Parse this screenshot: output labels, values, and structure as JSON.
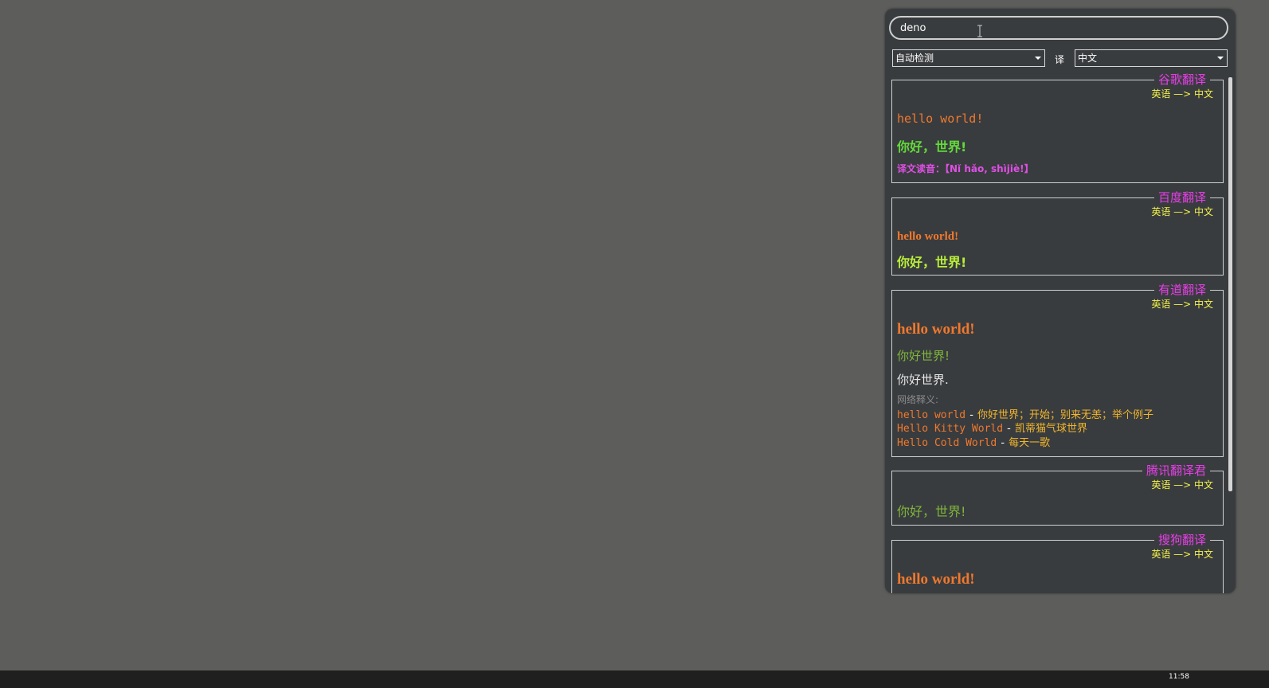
{
  "search": {
    "value": "deno"
  },
  "controls": {
    "source_lang": "自动检测",
    "translate_label": "译",
    "target_lang": "中文"
  },
  "results": [
    {
      "engine": "谷歌翻译",
      "direction": "英语 —> 中文",
      "source_text": "hello world!",
      "translation": "你好，世界!",
      "pronunciation": "译文读音：【Nǐ hǎo, shìjiè!】"
    },
    {
      "engine": "百度翻译",
      "direction": "英语 —> 中文",
      "source_text": "hello world!",
      "translation": "你好，世界!"
    },
    {
      "engine": "有道翻译",
      "direction": "英语 —> 中文",
      "source_text": "hello world!",
      "translation": "你好世界!",
      "translation_alt": "你好世界.",
      "web_label": "网络释义:",
      "web_entries": [
        {
          "key": "hello world",
          "value": "你好世界；开始；别来无恙；举个例子"
        },
        {
          "key": "Hello Kitty World",
          "value": "凯蒂猫气球世界"
        },
        {
          "key": "Hello Cold World",
          "value": "每天一歌"
        }
      ]
    },
    {
      "engine": "腾讯翻译君",
      "direction": "英语 —> 中文",
      "translation": "你好，世界!"
    },
    {
      "engine": "搜狗翻译",
      "direction": "英语 —> 中文",
      "source_text": "hello world!"
    }
  ],
  "taskbar": {
    "clock": "11:58"
  }
}
